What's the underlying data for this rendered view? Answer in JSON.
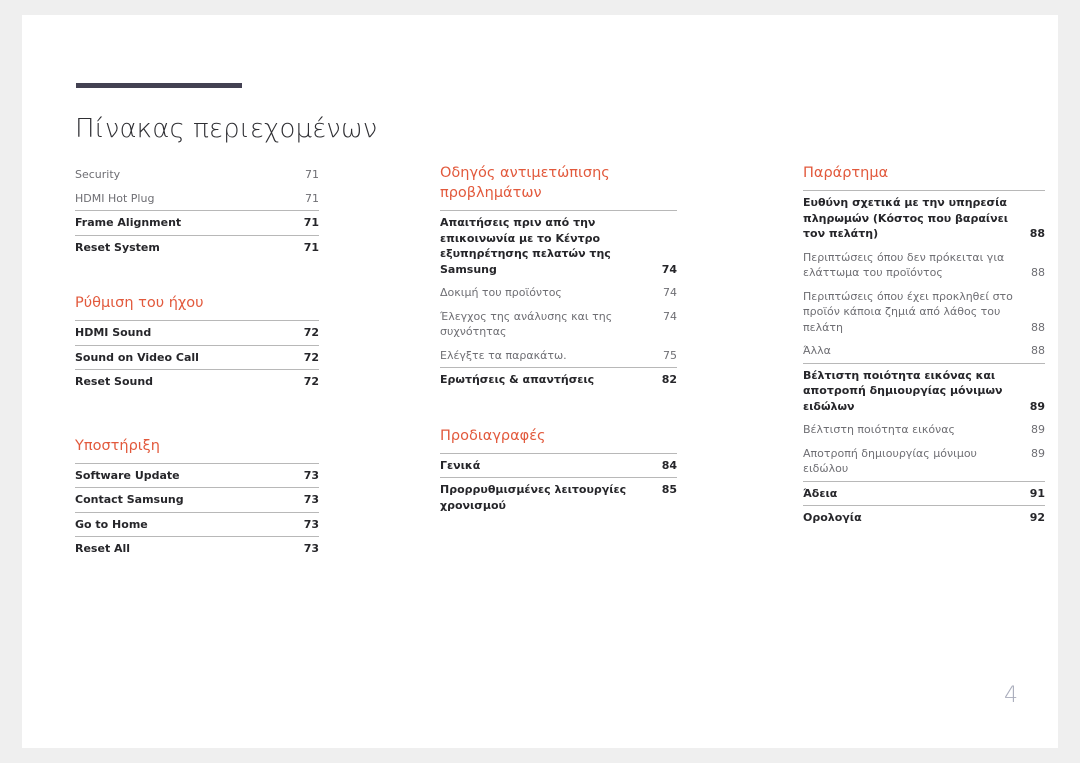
{
  "document": {
    "title": "Πίνακας περιεχομένων",
    "page_number": "4",
    "accent_color": "#e2593c",
    "rule_color": "#434152"
  },
  "columns": [
    {
      "id": "column-1",
      "sections": [
        {
          "heading": null,
          "entries": [
            {
              "label": "Security",
              "page": "71",
              "level": 2,
              "rule": false
            },
            {
              "label": "HDMI Hot Plug",
              "page": "71",
              "level": 2,
              "rule": false
            },
            {
              "label": "Frame Alignment",
              "page": "71",
              "level": 1,
              "rule": true
            },
            {
              "label": "Reset System",
              "page": "71",
              "level": 1,
              "rule": true
            }
          ]
        },
        {
          "heading": "Ρύθμιση του ήχου",
          "entries": [
            {
              "label": "HDMI Sound",
              "page": "72",
              "level": 1,
              "rule": true
            },
            {
              "label": "Sound on Video Call",
              "page": "72",
              "level": 1,
              "rule": true
            },
            {
              "label": "Reset Sound",
              "page": "72",
              "level": 1,
              "rule": true
            }
          ]
        },
        {
          "heading": "Υποστήριξη",
          "entries": [
            {
              "label": "Software Update",
              "page": "73",
              "level": 1,
              "rule": true
            },
            {
              "label": "Contact Samsung",
              "page": "73",
              "level": 1,
              "rule": true
            },
            {
              "label": "Go to Home",
              "page": "73",
              "level": 1,
              "rule": true
            },
            {
              "label": "Reset All",
              "page": "73",
              "level": 1,
              "rule": true
            }
          ]
        }
      ]
    },
    {
      "id": "column-2",
      "sections": [
        {
          "heading": "Οδηγός αντιμετώπισης προβλημάτων",
          "entries": [
            {
              "label": "Απαιτήσεις πριν από την επικοινωνία με το Κέντρο εξυπηρέτησης πελατών της Samsung",
              "page": "74",
              "level": 1,
              "rule": true,
              "multiline": true
            },
            {
              "label": "Δοκιμή του προϊόντος",
              "page": "74",
              "level": 2,
              "rule": false
            },
            {
              "label": "Έλεγχος της ανάλυσης και της συχνότητας",
              "page": "74",
              "level": 2,
              "rule": false
            },
            {
              "label": "Ελέγξτε τα παρακάτω.",
              "page": "75",
              "level": 2,
              "rule": false
            },
            {
              "label": "Ερωτήσεις & απαντήσεις",
              "page": "82",
              "level": 1,
              "rule": true
            }
          ]
        },
        {
          "heading": "Προδιαγραφές",
          "entries": [
            {
              "label": "Γενικά",
              "page": "84",
              "level": 1,
              "rule": true
            },
            {
              "label": "Προρρυθμισμένες λειτουργίες χρονισμού",
              "page": "85",
              "level": 1,
              "rule": true
            }
          ]
        }
      ]
    },
    {
      "id": "column-3",
      "sections": [
        {
          "heading": "Παράρτημα",
          "entries": [
            {
              "label": "Ευθύνη σχετικά με την υπηρεσία πληρωμών (Κόστος που βαραίνει τον πελάτη)",
              "page": "88",
              "level": 1,
              "rule": true,
              "multiline": true
            },
            {
              "label": "Περιπτώσεις όπου δεν πρόκειται για ελάττωμα του προϊόντος",
              "page": "88",
              "level": 2,
              "rule": false,
              "multiline": true
            },
            {
              "label": "Περιπτώσεις όπου έχει προκληθεί στο προϊόν κάποια ζημιά από λάθος του πελάτη",
              "page": "88",
              "level": 2,
              "rule": false,
              "multiline": true
            },
            {
              "label": "Άλλα",
              "page": "88",
              "level": 2,
              "rule": false
            },
            {
              "label": "Βέλτιστη ποιότητα εικόνας και αποτροπή δημιουργίας μόνιμων ειδώλων",
              "page": "89",
              "level": 1,
              "rule": true,
              "multiline": true
            },
            {
              "label": "Βέλτιστη ποιότητα εικόνας",
              "page": "89",
              "level": 2,
              "rule": false
            },
            {
              "label": "Αποτροπή δημιουργίας μόνιμου ειδώλου",
              "page": "89",
              "level": 2,
              "rule": false
            },
            {
              "label": "Άδεια",
              "page": "91",
              "level": 1,
              "rule": true
            },
            {
              "label": "Ορολογία",
              "page": "92",
              "level": 1,
              "rule": true
            }
          ]
        }
      ]
    }
  ]
}
